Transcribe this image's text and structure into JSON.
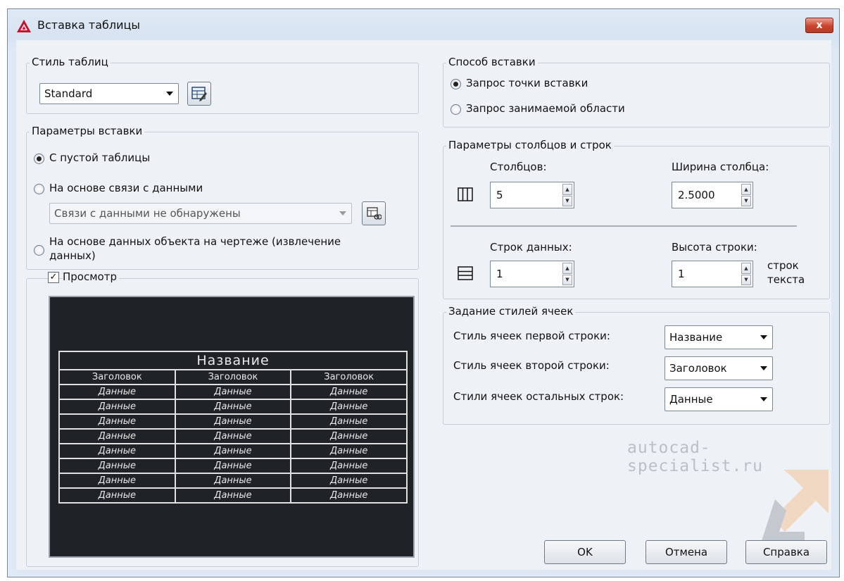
{
  "window": {
    "title": "Вставка таблицы",
    "close_label": "x"
  },
  "table_style": {
    "legend": "Стиль таблиц",
    "selected": "Standard"
  },
  "insert_options": {
    "legend": "Параметры вставки",
    "option_empty": "С пустой таблицы",
    "option_data_link": "На основе связи с данными",
    "data_link_combo": "Связи с данными не обнаружены",
    "option_object_data_line1": "На основе данных объекта на чертеже (извлечение",
    "option_object_data_line2": "данных)",
    "preview_label": "Просмотр",
    "preview_checked": true
  },
  "insert_method": {
    "legend": "Способ вставки",
    "option_point": "Запрос точки вставки",
    "option_window": "Запрос занимаемой области"
  },
  "col_row": {
    "legend": "Параметры столбцов и строк",
    "columns_label": "Столбцов:",
    "columns_value": "5",
    "col_width_label": "Ширина столбца:",
    "col_width_value": "2.5000",
    "data_rows_label": "Строк данных:",
    "data_rows_value": "1",
    "row_height_label": "Высота строки:",
    "row_height_value": "1",
    "row_height_unit_line1": "строк",
    "row_height_unit_line2": "текста"
  },
  "cell_styles": {
    "legend": "Задание стилей ячеек",
    "first_row_label": "Стиль ячеек первой строки:",
    "first_row_value": "Название",
    "second_row_label": "Стиль ячеек второй строки:",
    "second_row_value": "Заголовок",
    "other_rows_label": "Стили ячеек остальных строк:",
    "other_rows_value": "Данные"
  },
  "preview_table": {
    "title": "Название",
    "headers": [
      "Заголовок",
      "Заголовок",
      "Заголовок"
    ],
    "rows": [
      [
        "Данные",
        "Данные",
        "Данные"
      ],
      [
        "Данные",
        "Данные",
        "Данные"
      ],
      [
        "Данные",
        "Данные",
        "Данные"
      ],
      [
        "Данные",
        "Данные",
        "Данные"
      ],
      [
        "Данные",
        "Данные",
        "Данные"
      ],
      [
        "Данные",
        "Данные",
        "Данные"
      ],
      [
        "Данные",
        "Данные",
        "Данные"
      ],
      [
        "Данные",
        "Данные",
        "Данные"
      ]
    ]
  },
  "watermark": "autocad-specialist.ru",
  "buttons": {
    "ok": "OK",
    "cancel": "Отмена",
    "help": "Справка"
  },
  "colors": {
    "title_bar": "#d7e3f1",
    "close": "#c9452f",
    "preview_bg": "#1f2328"
  }
}
